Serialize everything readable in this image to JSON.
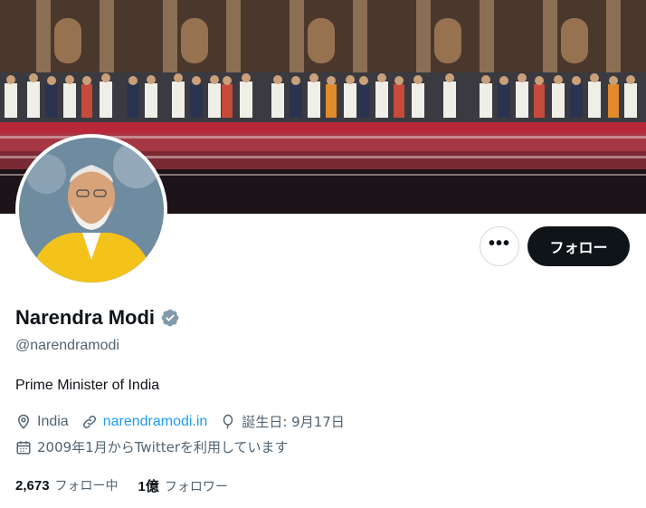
{
  "profile": {
    "name": "Narendra Modi",
    "handle": "@narendramodi",
    "bio": "Prime Minister of India",
    "location": "India",
    "website": "narendramodi.in",
    "birthday": "誕生日: 9月17日",
    "joined": "2009年1月からTwitterを利用しています",
    "verified_badge_color": "#829aab"
  },
  "actions": {
    "more_label": "•••",
    "follow_label": "フォロー"
  },
  "stats": {
    "following_count": "2,673",
    "following_label": "フォロー中",
    "followers_count": "1億",
    "followers_label": "フォロワー"
  },
  "icons": {
    "more": "more-icon",
    "verified": "verified-badge-icon",
    "location": "location-pin-icon",
    "link": "link-icon",
    "birthday": "balloon-icon",
    "calendar": "calendar-icon"
  }
}
